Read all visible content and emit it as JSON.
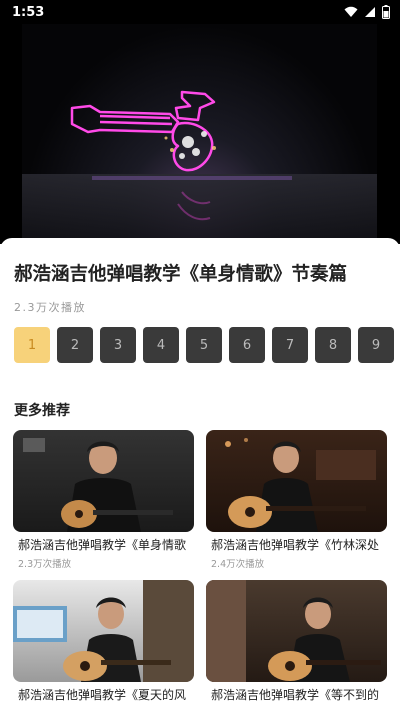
{
  "status": {
    "time": "1:53"
  },
  "video": {
    "title": "郝浩涵吉他弹唱教学《单身情歌》节奏篇",
    "plays": "2.3万次播放"
  },
  "episodes": [
    "1",
    "2",
    "3",
    "4",
    "5",
    "6",
    "7",
    "8",
    "9"
  ],
  "section_title": "更多推荐",
  "recommendations": [
    {
      "caption": "郝浩涵吉他弹唱教学《单身情歌",
      "views": "2.3万次播放"
    },
    {
      "caption": "郝浩涵吉他弹唱教学《竹林深处",
      "views": "2.4万次播放"
    },
    {
      "caption": "郝浩涵吉他弹唱教学《夏天的风",
      "views": ""
    },
    {
      "caption": "郝浩涵吉他弹唱教学《等不到的",
      "views": ""
    }
  ],
  "colors": {
    "accent": "#f7d27a",
    "accent_text": "#c88a20",
    "chip_bg": "#3a3a3a",
    "neon_pink": "#e040d0"
  },
  "icons": [
    "wifi-icon",
    "signal-icon",
    "battery-icon"
  ]
}
